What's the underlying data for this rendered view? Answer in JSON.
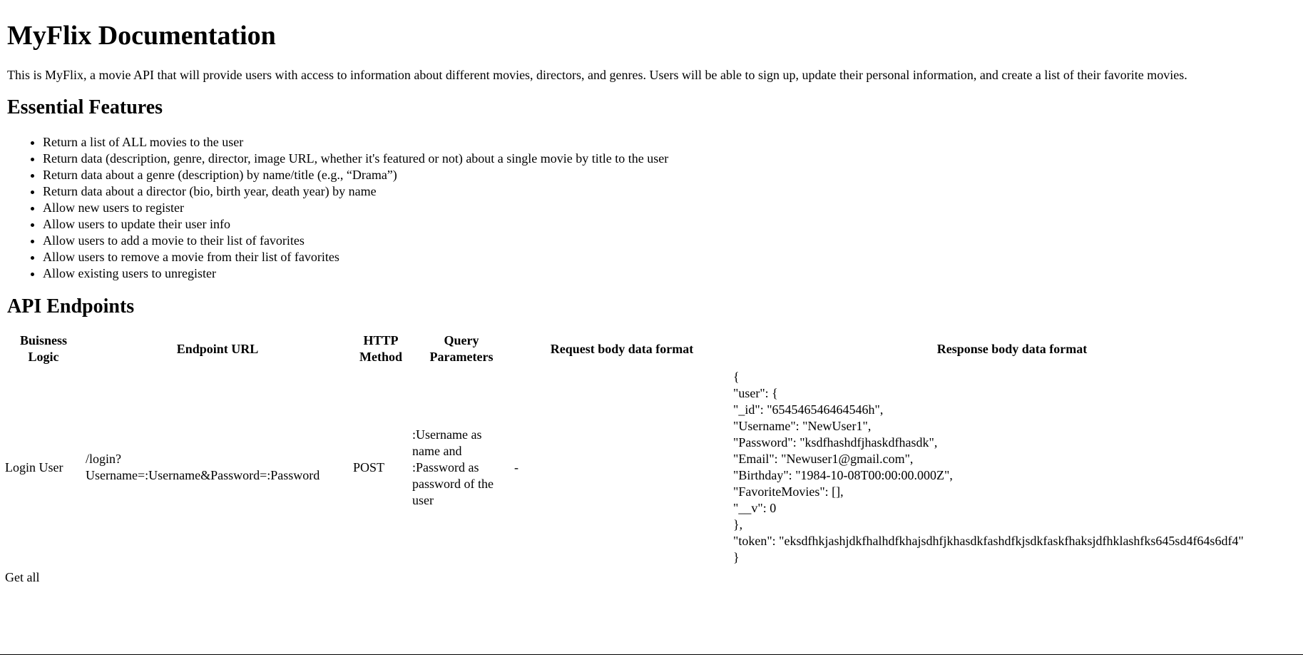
{
  "title": "MyFlix Documentation",
  "intro": "This is MyFlix, a movie API that will provide users with access to information about different movies, directors, and genres. Users will be able to sign up, update their personal information, and create a list of their favorite movies.",
  "features": {
    "heading": "Essential Features",
    "items": [
      "Return a list of ALL movies to the user",
      "Return data (description, genre, director, image URL, whether it's featured or not) about a single movie by title to the user",
      "Return data about a genre (description) by name/title (e.g., “Drama”)",
      "Return data about a director (bio, birth year, death year) by name",
      "Allow new users to register",
      "Allow users to update their user info",
      "Allow users to add a movie to their list of favorites",
      "Allow users to remove a movie from their list of favorites",
      "Allow existing users to unregister"
    ]
  },
  "endpoints": {
    "heading": "API Endpoints",
    "headers": {
      "logic": "Buisness Logic",
      "url": "Endpoint URL",
      "method": "HTTP Method",
      "query": "Query Parameters",
      "request": "Request body data format",
      "response": "Response body data format"
    },
    "rows": [
      {
        "logic": "Login User",
        "url": "/login?Username=:Username&Password=:Password",
        "method": "POST",
        "query": ":Username as name and :Password as password of the user",
        "request": "-",
        "response": {
          "l1": "{",
          "l2": "\"user\": {",
          "l3": "\"_id\": \"654546546464546h\",",
          "l4": "\"Username\": \"NewUser1\",",
          "l5": "\"Password\": \"ksdfhashdfjhaskdfhasdk\",",
          "l6": "\"Email\": \"Newuser1@gmail.com\",",
          "l7": "\"Birthday\": \"1984-10-08T00:00:00.000Z\",",
          "l8": "\"FavoriteMovies\": [],",
          "l9": "\"__v\": 0",
          "l10": "},",
          "l11": "\"token\": \"eksdfhkjashjdkfhalhdfkhajsdhfjkhasdkfashdfkjsdkfaskfhaksjdfhklashfks645sd4f64s6df4\"",
          "l12": "}"
        }
      },
      {
        "logic": "Get all"
      }
    ]
  }
}
